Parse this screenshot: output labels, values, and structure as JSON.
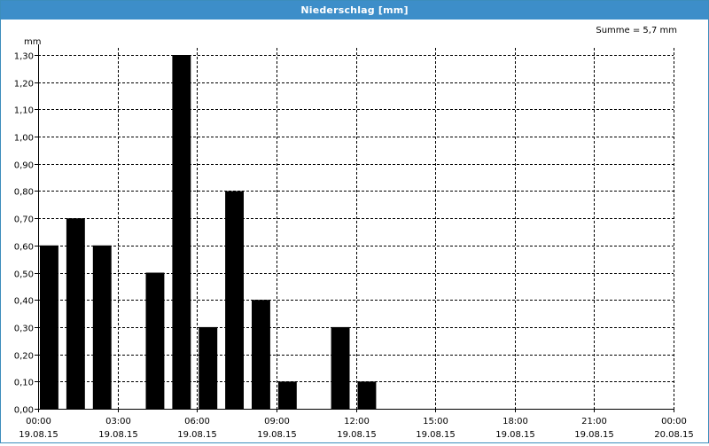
{
  "window": {
    "title": "Niederschlag [mm]"
  },
  "chart_data": {
    "type": "bar",
    "title": "Niederschlag [mm]",
    "ylabel": "mm",
    "sum_label": "Summe = 5,7 mm",
    "ylim": [
      0,
      1.3
    ],
    "y_ticks": [
      "0,00",
      "0,10",
      "0,20",
      "0,30",
      "0,40",
      "0,50",
      "0,60",
      "0,70",
      "0,80",
      "0,90",
      "1,00",
      "1,10",
      "1,20",
      "1,30"
    ],
    "x_ticks": [
      {
        "time": "00:00",
        "date": "19.08.15"
      },
      {
        "time": "03:00",
        "date": "19.08.15"
      },
      {
        "time": "06:00",
        "date": "19.08.15"
      },
      {
        "time": "09:00",
        "date": "19.08.15"
      },
      {
        "time": "12:00",
        "date": "19.08.15"
      },
      {
        "time": "15:00",
        "date": "19.08.15"
      },
      {
        "time": "18:00",
        "date": "19.08.15"
      },
      {
        "time": "21:00",
        "date": "19.08.15"
      },
      {
        "time": "00:00",
        "date": "20.08.15"
      }
    ],
    "interval_hours": 1,
    "categories": [
      "00:00",
      "01:00",
      "02:00",
      "03:00",
      "04:00",
      "05:00",
      "06:00",
      "07:00",
      "08:00",
      "09:00",
      "10:00",
      "11:00",
      "12:00",
      "13:00",
      "14:00",
      "15:00",
      "16:00",
      "17:00",
      "18:00",
      "19:00",
      "20:00",
      "21:00",
      "22:00",
      "23:00"
    ],
    "values": [
      0.6,
      0.7,
      0.6,
      0,
      0.5,
      1.3,
      0.3,
      0.8,
      0.4,
      0.1,
      0,
      0.3,
      0.1,
      0,
      0,
      0,
      0,
      0,
      0,
      0,
      0,
      0,
      0,
      0
    ],
    "bar_color": "#000000",
    "grid": true
  }
}
